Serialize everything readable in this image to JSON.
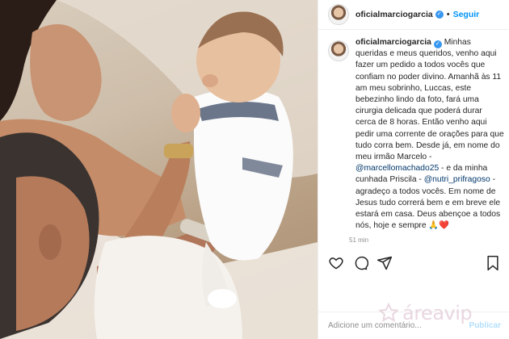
{
  "post": {
    "username": "oficialmarciogarcia",
    "follow_label": "Seguir",
    "separator": "•",
    "caption": {
      "author": "oficialmarciogarcia",
      "text_1": " Minhas queridas e meus queridos, venho aqui fazer um pedido a todos vocês que confiam no poder divino. Amanhã às 11 am meu sobrinho, Luccas, este bebezinho lindo da foto, fará uma cirurgia delicada que poderá durar cerca de 8 horas. Então venho aqui pedir uma corrente de orações para que tudo corra bem. Desde já, em nome do meu irmão Marcelo - ",
      "mention_1": "@marcellomachado25",
      "text_2": " - e da minha cunhada Priscila - ",
      "mention_2": "@nutri_prifragoso",
      "text_3": " - agradeço a todos vocês. Em nome de Jesus tudo correrá bem e em breve ele estará em casa. Deus abençoe a todos nós, hoje e sempre 🙏❤️"
    },
    "time": "51 min",
    "comment_placeholder": "Adicione um comentário...",
    "publish_label": "Publicar"
  },
  "watermark": {
    "text": "áreavip"
  },
  "colors": {
    "link": "#0095f6",
    "mention": "#00376b",
    "verified": "#3897f0",
    "muted": "#8e8e8e"
  },
  "icons": [
    "heart-icon",
    "comment-icon",
    "share-icon",
    "bookmark-icon",
    "verified-icon"
  ]
}
